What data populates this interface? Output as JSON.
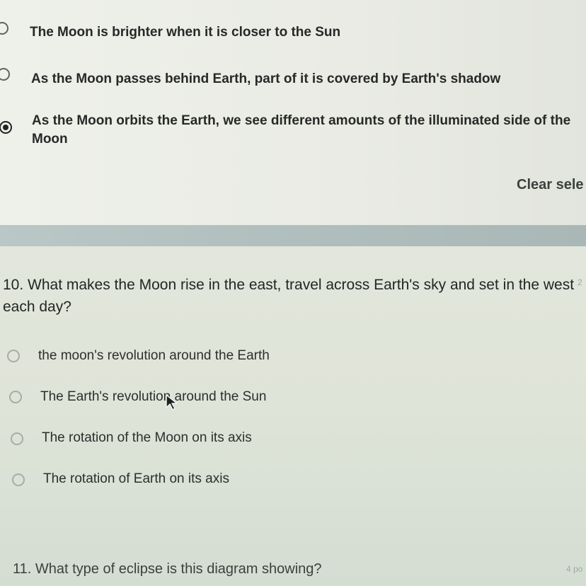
{
  "prev_question": {
    "options": [
      {
        "label": "The Moon is brighter when it is closer to the Sun",
        "selected": false
      },
      {
        "label": "As the Moon passes behind Earth, part of it is covered by Earth's shadow",
        "selected": false
      },
      {
        "label": "As the Moon orbits the Earth, we see different amounts of the illuminated side of the Moon",
        "selected": true
      }
    ],
    "clear_label": "Clear sele"
  },
  "question10": {
    "title": "10. What makes the Moon rise in the east, travel across Earth's sky and set in the west each day?",
    "points": "2",
    "options": [
      {
        "label": "the moon's revolution around the Earth",
        "selected": false
      },
      {
        "label": "The Earth's revolution around the Sun",
        "selected": false
      },
      {
        "label": "The rotation of the Moon on its axis",
        "selected": false
      },
      {
        "label": "The rotation of Earth on its axis",
        "selected": false
      }
    ]
  },
  "question11": {
    "title": "11. What type of eclipse is this diagram showing?",
    "points": "4 po"
  },
  "colors": {
    "card_bg": "#eef0ea",
    "divider": "#b9c7c6",
    "radio_selected": "#1f2422"
  },
  "icons": {
    "cursor": "mouse-pointer-arrow-icon"
  }
}
